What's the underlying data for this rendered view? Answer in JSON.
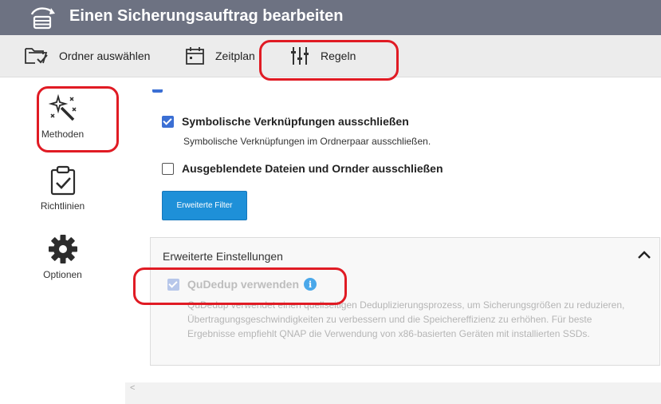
{
  "window": {
    "title": "Einen Sicherungsauftrag bearbeiten",
    "accent_color": "#6d7282"
  },
  "toolbar": {
    "items": [
      {
        "label": "Ordner auswählen",
        "icon": "folder-check-icon"
      },
      {
        "label": "Zeitplan",
        "icon": "calendar-icon"
      },
      {
        "label": "Regeln",
        "icon": "sliders-icon"
      }
    ]
  },
  "sidebar": {
    "items": [
      {
        "label": "Methoden",
        "icon": "magic-wand-icon",
        "selected": true
      },
      {
        "label": "Richtlinien",
        "icon": "clipboard-check-icon"
      },
      {
        "label": "Optionen",
        "icon": "gear-icon"
      }
    ]
  },
  "content": {
    "symlinks": {
      "label": "Symbolische Verknüpfungen ausschließen",
      "description": "Symbolische Verknüpfungen im Ordnerpaar ausschließen.",
      "checked": true
    },
    "hidden_files": {
      "label": "Ausgeblendete Dateien und Ornder ausschließen",
      "checked": false
    },
    "filter_button": "Erweiterte Filter",
    "advanced": {
      "title": "Erweiterte Einstellungen",
      "qudedup": {
        "label": "QuDedup verwenden",
        "checked": true,
        "disabled": true,
        "description": "QuDedup verwendet einen quellseitigen Deduplizierungsprozess, um Sicherungsgrößen zu reduzieren, Übertragungsgeschwindigkeiten zu verbessern und die Speichereffizienz zu erhöhen. Für beste Ergebnisse empfiehlt QNAP die Verwendung von x86-basierten Geräten mit installierten SSDs."
      }
    }
  },
  "colors": {
    "checkbox": "#3b6fd4",
    "button": "#1e90d8",
    "annotation": "#e01b24",
    "info": "#4aa8ea"
  }
}
